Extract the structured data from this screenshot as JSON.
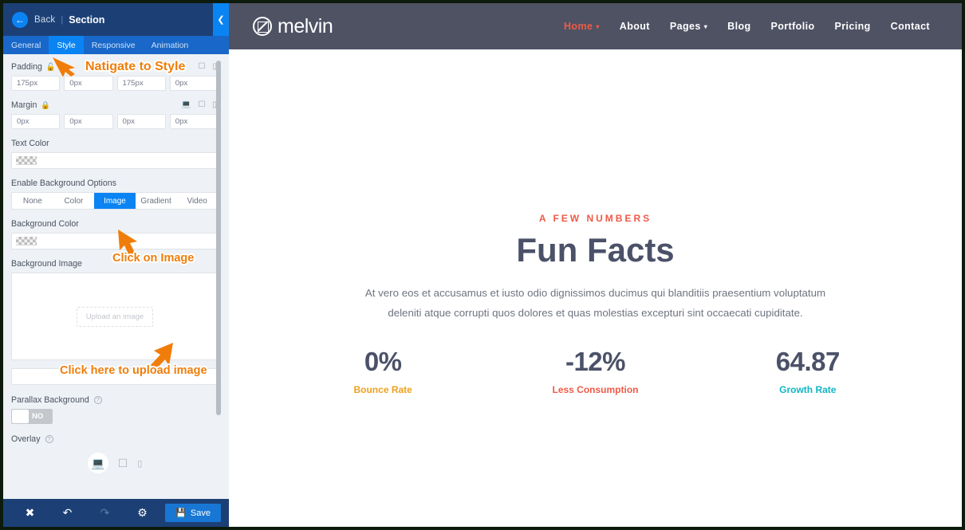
{
  "panel": {
    "header": {
      "back_label": "Back",
      "separator": "|",
      "title": "Section",
      "back_icon": "arrow-left-icon",
      "collapse_icon": "chevron-left-icon"
    },
    "tabs": [
      {
        "label": "General",
        "active": false
      },
      {
        "label": "Style",
        "active": true
      },
      {
        "label": "Responsive",
        "active": false
      },
      {
        "label": "Animation",
        "active": false
      }
    ],
    "padding": {
      "label": "Padding",
      "values": [
        "175px",
        "0px",
        "175px",
        "0px"
      ]
    },
    "margin": {
      "label": "Margin",
      "values": [
        "0px",
        "0px",
        "0px",
        "0px"
      ]
    },
    "text_color": {
      "label": "Text Color",
      "value": "transparent"
    },
    "background_options": {
      "label": "Enable Background Options",
      "items": [
        "None",
        "Color",
        "Image",
        "Gradient",
        "Video"
      ],
      "selected": "Image"
    },
    "background_color": {
      "label": "Background Color",
      "value": "transparent"
    },
    "background_image": {
      "label": "Background Image",
      "upload_placeholder": "Upload an image"
    },
    "parallax": {
      "label": "Parallax Background",
      "toggle_value": "NO"
    },
    "overlay": {
      "label": "Overlay"
    },
    "device_switch": {
      "desktop": "desktop-icon",
      "tablet": "tablet-icon",
      "mobile": "mobile-icon",
      "active": "desktop"
    },
    "footer": {
      "close_icon": "close-icon",
      "undo_icon": "undo-icon",
      "redo_icon": "redo-icon",
      "settings_icon": "gear-icon",
      "save_label": "Save",
      "save_icon": "floppy-disk-icon"
    }
  },
  "annotations": [
    {
      "text": "Natigate to Style"
    },
    {
      "text": "Click on Image"
    },
    {
      "text": "Click here to upload image"
    }
  ],
  "preview": {
    "brand": "melvin",
    "nav": [
      {
        "label": "Home",
        "active": true,
        "has_caret": true
      },
      {
        "label": "About",
        "active": false,
        "has_caret": false
      },
      {
        "label": "Pages",
        "active": false,
        "has_caret": true
      },
      {
        "label": "Blog",
        "active": false,
        "has_caret": false
      },
      {
        "label": "Portfolio",
        "active": false,
        "has_caret": false
      },
      {
        "label": "Pricing",
        "active": false,
        "has_caret": false
      },
      {
        "label": "Contact",
        "active": false,
        "has_caret": false
      }
    ],
    "section": {
      "eyebrow": "A FEW NUMBERS",
      "title": "Fun Facts",
      "description": "At vero eos et accusamus et iusto odio dignissimos ducimus qui blanditiis praesentium voluptatum deleniti atque corrupti quos dolores et quas molestias excepturi sint occaecati cupiditate."
    },
    "stats": [
      {
        "value": "0%",
        "label": "Bounce Rate",
        "color": "#f0a01e"
      },
      {
        "value": "-12%",
        "label": "Less Consumption",
        "color": "#f05a46"
      },
      {
        "value": "64.87",
        "label": "Growth Rate",
        "color": "#12b5c4"
      }
    ]
  },
  "colors": {
    "panel_header": "#1c4076",
    "tab_active": "#0b84f3",
    "accent_orange": "#f07d0a",
    "site_nav": "#4f5263",
    "heading": "#4b5168",
    "brand_red": "#f05a46"
  }
}
